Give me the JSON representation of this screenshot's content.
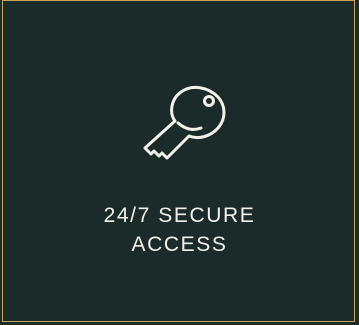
{
  "feature_card": {
    "icon": "key-icon",
    "title_line_1": "24/7 SECURE",
    "title_line_2": "ACCESS",
    "colors": {
      "background": "#1b2b29",
      "border": "#c9a35a",
      "text": "#f3f2ea"
    }
  }
}
